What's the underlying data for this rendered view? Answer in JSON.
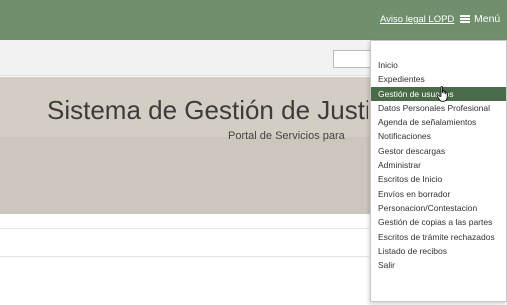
{
  "header": {
    "legal_link": "Aviso legal LOPD",
    "menu_label": "Menú",
    "menu_icon": "hamburger-icon"
  },
  "hero": {
    "title": "Sistema de Gestión de Justicia",
    "subtitle": "Portal de Servicios para"
  },
  "menu": {
    "items": [
      "Inicio",
      "Expedientes",
      "Gestión de usuarios",
      "Datos Personales Profesional",
      "Agenda de señalamientos",
      "Notificaciones",
      "Gestor descargas",
      "Administrar",
      "Escritos de Inicio",
      "Envíos en borrador",
      "Personacion/Contestacion",
      "Gestión de copias a las partes",
      "Escritos de trámite rechazados",
      "Listado de recibos",
      "Salir"
    ],
    "active_index": 2
  },
  "colors": {
    "header_bg": "#6f8f6d",
    "active_item_bg": "#4a6b49",
    "hero_bg": "#d3cdc4"
  }
}
